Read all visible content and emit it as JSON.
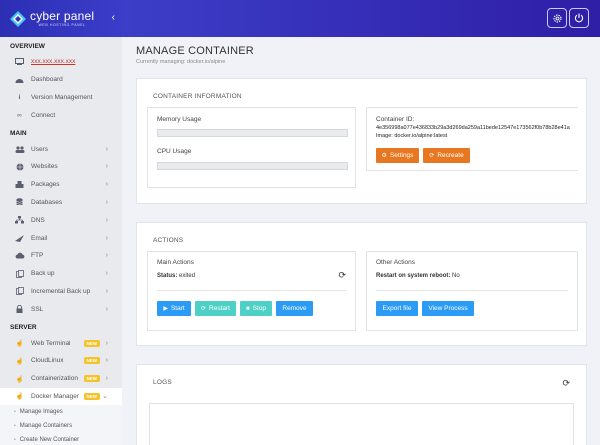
{
  "brand": {
    "name": "cyber panel",
    "tagline": "WEB HOSTING PANEL"
  },
  "sidebar": {
    "sections": {
      "overview": "OVERVIEW",
      "main": "MAIN",
      "server": "SERVER"
    },
    "overview_items": [
      {
        "label": "xxx.xxx.xxx.xxx",
        "icon": "monitor-icon"
      },
      {
        "label": "Dashboard",
        "icon": "dashboard-icon"
      },
      {
        "label": "Version Management",
        "icon": "info-icon"
      },
      {
        "label": "Connect",
        "icon": "link-icon"
      }
    ],
    "main_items": [
      {
        "label": "Users",
        "icon": "users-icon"
      },
      {
        "label": "Websites",
        "icon": "globe-icon"
      },
      {
        "label": "Packages",
        "icon": "packages-icon"
      },
      {
        "label": "Databases",
        "icon": "database-icon"
      },
      {
        "label": "DNS",
        "icon": "dns-icon"
      },
      {
        "label": "Email",
        "icon": "email-icon"
      },
      {
        "label": "FTP",
        "icon": "cloud-upload-icon"
      },
      {
        "label": "Back up",
        "icon": "backup-icon"
      },
      {
        "label": "Incremental Back up",
        "icon": "incremental-backup-icon"
      },
      {
        "label": "SSL",
        "icon": "lock-icon"
      }
    ],
    "server_items": [
      {
        "label": "Web Terminal",
        "icon": "pointer-icon",
        "badge": "NEW"
      },
      {
        "label": "CloudLinux",
        "icon": "pointer-icon",
        "badge": "NEW"
      },
      {
        "label": "Containerization",
        "icon": "pointer-icon",
        "badge": "NEW"
      },
      {
        "label": "Docker Manager",
        "icon": "pointer-icon",
        "badge": "NEW"
      }
    ],
    "sub_items": [
      "Manage Images",
      "Manage Containers",
      "Create New Container"
    ]
  },
  "page": {
    "title": "MANAGE CONTAINER",
    "subtitle": "Currently managing: docker.io/alpine"
  },
  "container_info": {
    "title": "CONTAINER INFORMATION",
    "memory_label": "Memory Usage",
    "cpu_label": "CPU Usage",
    "id_label": "Container ID:",
    "id_value": "4e356998a077e436833b29a3d269da259a11bede12547e173562f0b78b28e41a",
    "image_label": "Image: docker.io/alpine:latest",
    "settings_btn": "Settings",
    "recreate_btn": "Recreate"
  },
  "actions": {
    "title": "ACTIONS",
    "main_title": "Main Actions",
    "status_label": "Status:",
    "status_value": "exited",
    "other_title": "Other Actions",
    "restart_label": "Restart on system reboot:",
    "restart_value": "No",
    "start_btn": "Start",
    "restart_btn": "Restart",
    "stop_btn": "Stop",
    "remove_btn": "Remove",
    "export_btn": "Export file",
    "process_btn": "View Process"
  },
  "logs": {
    "title": "LOGS"
  },
  "colors": {
    "header": "#3b3dc9",
    "orange": "#e87722",
    "blue": "#2b9bf5",
    "teal": "#4ed0c6",
    "badge": "#f6c22b"
  }
}
